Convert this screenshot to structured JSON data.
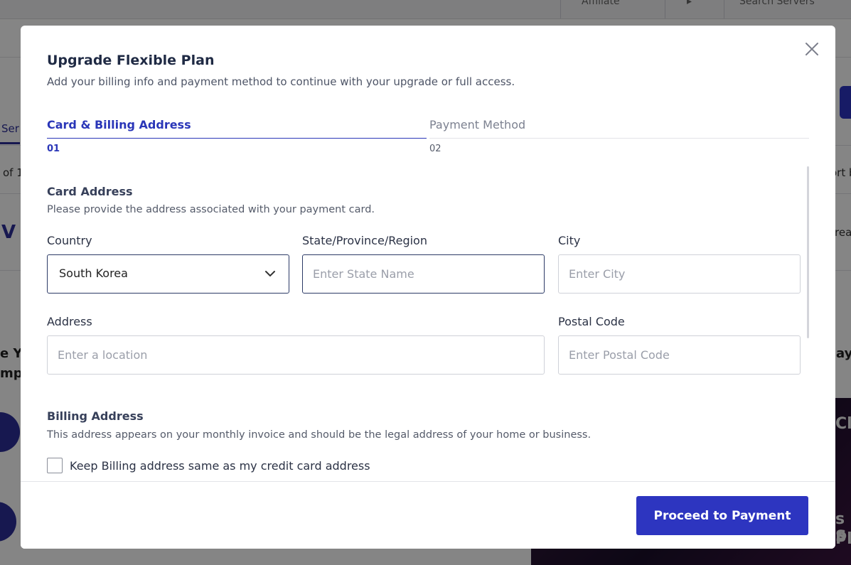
{
  "background": {
    "top_items": [
      "Affiliate",
      "Search Servers"
    ],
    "left_tab_fragment": "Ser",
    "left_count_fragment": "of 1",
    "right_sort_fragment": "ort b",
    "left_logo_fragment": "V",
    "right_crea_fragment": "rea",
    "left_heading_fragment_1": "e Y",
    "left_heading_fragment_2": "mp",
    "right_heading_fragment": "ays",
    "promo_fragment_1": "Clo",
    "promo_fragment_2": "s S",
    "promo_fragment_3": "Pl"
  },
  "modal": {
    "title": "Upgrade Flexible Plan",
    "subtitle": "Add your billing info and payment method to continue with your upgrade or full access.",
    "close_icon": "close-icon",
    "steps": [
      {
        "label": "Card & Billing Address",
        "number": "01",
        "active": true
      },
      {
        "label": "Payment Method",
        "number": "02",
        "active": false
      }
    ],
    "card_address": {
      "title": "Card Address",
      "description": "Please provide the address associated with your payment card.",
      "country": {
        "label": "Country",
        "value": "South Korea"
      },
      "state": {
        "label": "State/Province/Region",
        "placeholder": "Enter State Name"
      },
      "city": {
        "label": "City",
        "placeholder": "Enter City"
      },
      "address": {
        "label": "Address",
        "placeholder": "Enter a location"
      },
      "postal": {
        "label": "Postal Code",
        "placeholder": "Enter Postal Code"
      }
    },
    "billing_address": {
      "title": "Billing Address",
      "description": "This address appears on your monthly invoice and should be the legal address of your home or business.",
      "same_as_card_label": "Keep Billing address same as my credit card address",
      "same_as_card_checked": false
    },
    "footer": {
      "proceed_label": "Proceed to Payment"
    },
    "colors": {
      "accent": "#2d35c0",
      "active_step": "#2a36b8",
      "title": "#1f2a44"
    }
  }
}
